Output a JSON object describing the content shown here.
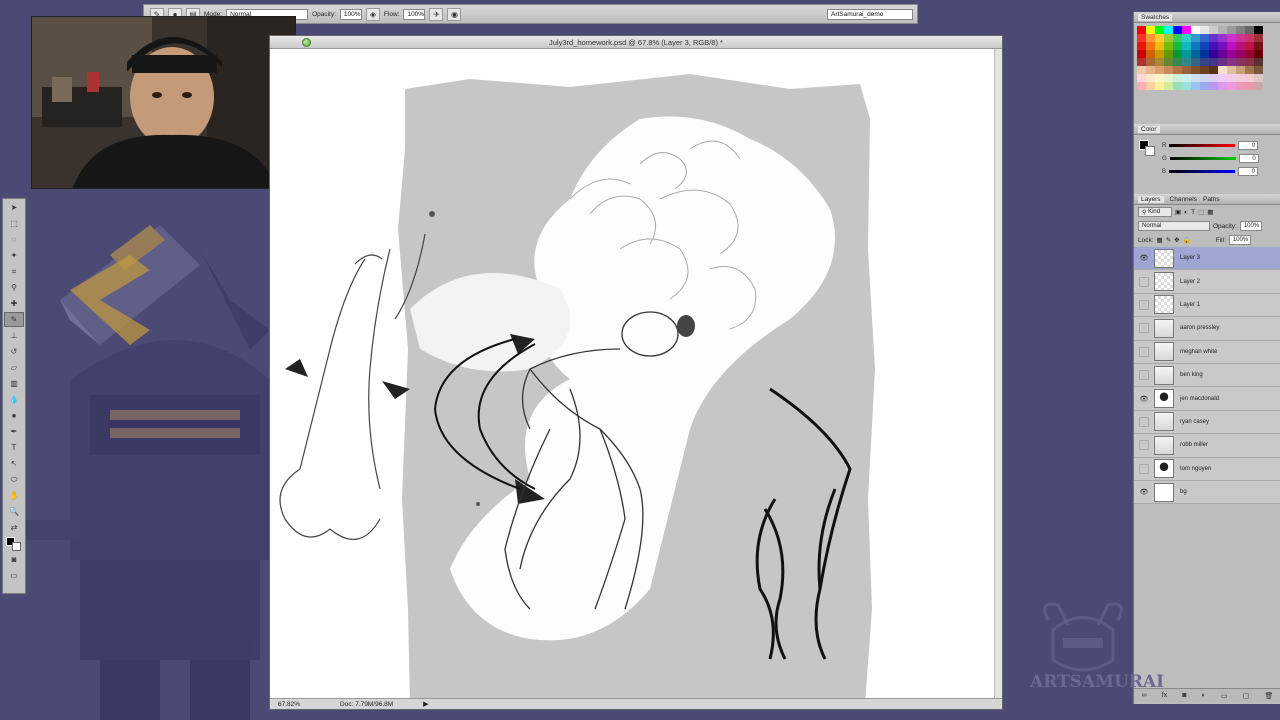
{
  "options_bar": {
    "mode_label": "Mode:",
    "mode_value": "Normal",
    "opacity_label": "Opacity:",
    "opacity_value": "100%",
    "flow_label": "Flow:",
    "flow_value": "100%",
    "workspace_value": "ArtSamurai_demo"
  },
  "document": {
    "title": "July3rd_homework.psd @ 67.8% (Layer 3, RGB/8) *",
    "zoom": "67.82%",
    "doc_size": "Doc: 7.79M/96.8M"
  },
  "panels": {
    "swatches_title": "Swatches",
    "color_title": "Color",
    "color_values": {
      "r": "0",
      "g": "0",
      "b": "0"
    },
    "color_channel_labels": {
      "r": "R",
      "g": "G",
      "b": "B"
    },
    "layers_tabs": [
      "Layers",
      "Channels",
      "Paths"
    ],
    "kind_label": "Kind",
    "blend_mode": "Normal",
    "opacity_label": "Opacity:",
    "opacity_value": "100%",
    "lock_label": "Lock:",
    "fill_label": "Fill:",
    "fill_value": "100%",
    "swatch_colors": [
      "#ff0000",
      "#ffff00",
      "#00ff00",
      "#00ffff",
      "#0000ff",
      "#ff00ff",
      "#ffffff",
      "#e5e5e5",
      "#cccccc",
      "#b2b2b2",
      "#999999",
      "#808080",
      "#666666",
      "#000000",
      "#ff3333",
      "#ff9933",
      "#ffcc33",
      "#99cc33",
      "#33cc66",
      "#33cccc",
      "#3399cc",
      "#3366cc",
      "#6633cc",
      "#9933cc",
      "#cc33cc",
      "#cc3399",
      "#cc3366",
      "#993333",
      "#ee1111",
      "#ee7711",
      "#eebb11",
      "#77bb11",
      "#11bb44",
      "#11bbbb",
      "#1177bb",
      "#1144bb",
      "#4411bb",
      "#7711bb",
      "#bb11bb",
      "#bb1177",
      "#bb1144",
      "#771111",
      "#cc0000",
      "#cc6600",
      "#cc9900",
      "#669900",
      "#009933",
      "#009999",
      "#006699",
      "#003399",
      "#330099",
      "#660099",
      "#990099",
      "#990066",
      "#990033",
      "#660000",
      "#aa3333",
      "#aa6633",
      "#aa8833",
      "#668833",
      "#338855",
      "#338888",
      "#336688",
      "#334488",
      "#443388",
      "#663388",
      "#883388",
      "#883366",
      "#883344",
      "#553333",
      "#f2c9a8",
      "#e8b48a",
      "#d9a070",
      "#c98b5a",
      "#b37548",
      "#9a6238",
      "#804f2b",
      "#6b3f20",
      "#583216",
      "#f7e0c9",
      "#e0c0a0",
      "#c8a078",
      "#a07850",
      "#785838",
      "#ffd5d5",
      "#ffe8cc",
      "#fff5cc",
      "#e6f5cc",
      "#ccf0dd",
      "#ccf0f0",
      "#cce0f5",
      "#ccd6f5",
      "#dcccf5",
      "#eeccf5",
      "#f5ccee",
      "#f5ccdd",
      "#f5ccd4",
      "#e0c8c8",
      "#ffb0b0",
      "#ffd0a0",
      "#ffee99",
      "#d0ee99",
      "#99e0bb",
      "#99e0e0",
      "#99c4ee",
      "#99aaee",
      "#bb99ee",
      "#dd99ee",
      "#ee99dd",
      "#ee99bb",
      "#ee99aa",
      "#c8a8a8"
    ]
  },
  "layers": [
    {
      "name": "Layer 3",
      "visible": true,
      "selected": true,
      "thumb": "checker"
    },
    {
      "name": "Layer 2",
      "visible": false,
      "selected": false,
      "thumb": "checker"
    },
    {
      "name": "Layer 1",
      "visible": false,
      "selected": false,
      "thumb": "checker"
    },
    {
      "name": "aaron pressley",
      "visible": false,
      "selected": false,
      "thumb": "photo"
    },
    {
      "name": "meghan white",
      "visible": false,
      "selected": false,
      "thumb": "photo"
    },
    {
      "name": "ben king",
      "visible": false,
      "selected": false,
      "thumb": "photo"
    },
    {
      "name": "jen macdonald",
      "visible": true,
      "selected": false,
      "thumb": "dark"
    },
    {
      "name": "ryan casey",
      "visible": false,
      "selected": false,
      "thumb": "photo"
    },
    {
      "name": "robb miller",
      "visible": false,
      "selected": false,
      "thumb": "photo"
    },
    {
      "name": "tom nguyen",
      "visible": false,
      "selected": false,
      "thumb": "dark"
    },
    {
      "name": "bg",
      "visible": true,
      "selected": false,
      "thumb": "white"
    }
  ],
  "watermark": {
    "text": "ARTSAMURAI"
  },
  "colors": {
    "background": "#4b4a74",
    "selected_layer": "#9fa6d3",
    "canvas_gray": "#c6c6c6"
  }
}
